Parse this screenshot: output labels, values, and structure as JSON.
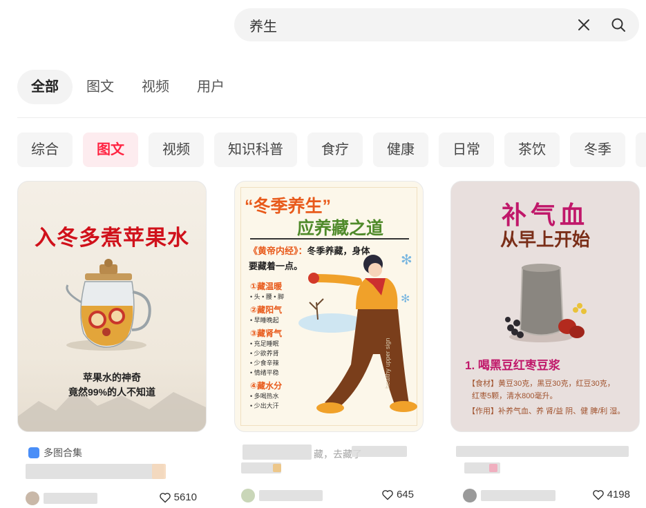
{
  "search": {
    "value": "养生"
  },
  "main_tabs": [
    "全部",
    "图文",
    "视频",
    "用户"
  ],
  "filters": [
    "综合",
    "图文",
    "视频",
    "知识科普",
    "食疗",
    "健康",
    "日常",
    "茶饮",
    "冬季"
  ],
  "cards": [
    {
      "cover": {
        "headline": "入冬多煮苹果水",
        "caption1": "苹果水的神奇",
        "caption2": "竟然99%的人不知道"
      },
      "badge": "多图合集",
      "likes": "5610"
    },
    {
      "cover": {
        "title1": "“冬季养生”",
        "title2": "应养藏之道",
        "quote_book": "《黄帝内经》：",
        "quote_a": "冬季养藏，身体",
        "quote_b": "要藏着一点。",
        "items": [
          {
            "head": "①藏温暖",
            "subs": [
              "• 头 • 腰 • 脚"
            ]
          },
          {
            "head": "②藏阳气",
            "subs": [
              "• 早睡晚起"
            ]
          },
          {
            "head": "③藏肾气",
            "subs": [
              "• 充足睡眠",
              "• 少欲养肾",
              "• 少食辛辣",
              "• 情绪平稳"
            ]
          },
          {
            "head": "④藏水分",
            "subs": [
              "• 多喝热水",
              "• 少出大汗"
            ]
          }
        ],
        "watermark": "healthy upper sign"
      },
      "snippet": "藏，去藏了",
      "likes": "645"
    },
    {
      "cover": {
        "title1": "补气血",
        "title2": "从早上开始",
        "recipe": "1. 喝黑豆红枣豆浆",
        "ing_a": "【食材】黄豆30克，黑豆30克，红豆30克，",
        "ing_b": "红枣5颗，清水800毫升。",
        "effect": "【作用】补养气血、养 肾/益 阴、健 脾/利 湿。"
      },
      "likes": "4198"
    }
  ],
  "colors": {
    "accent": "#ff2442",
    "headline_red": "#d0111b",
    "title_orange": "#e85a1b",
    "title_green": "#4f8a2a",
    "title_magenta": "#c0186a"
  }
}
